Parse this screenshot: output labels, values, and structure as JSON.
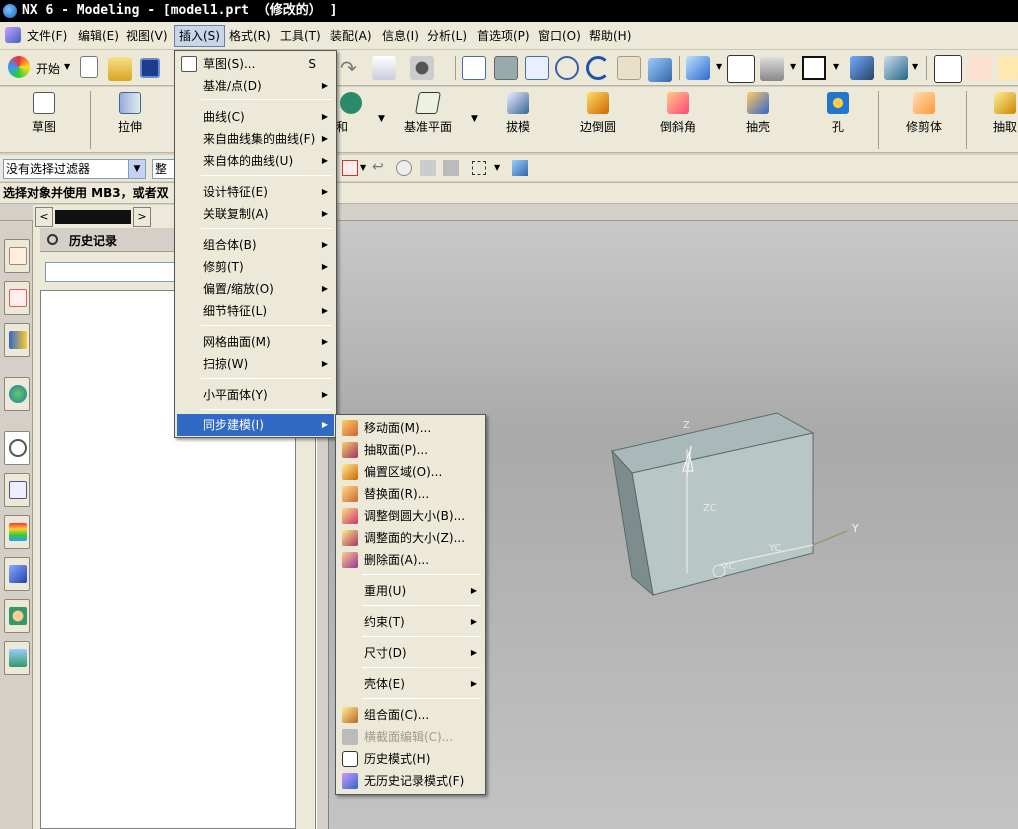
{
  "window": {
    "title": "NX 6 - Modeling - [model1.prt （修改的） ]"
  },
  "menubar": [
    {
      "label": "文件(F)"
    },
    {
      "label": "编辑(E)"
    },
    {
      "label": "视图(V)"
    },
    {
      "label": "插入(S)"
    },
    {
      "label": "格式(R)"
    },
    {
      "label": "工具(T)"
    },
    {
      "label": "装配(A)"
    },
    {
      "label": "信息(I)"
    },
    {
      "label": "分析(L)"
    },
    {
      "label": "首选项(P)"
    },
    {
      "label": "窗口(O)"
    },
    {
      "label": "帮助(H)"
    }
  ],
  "toolbar": {
    "start_label": "开始"
  },
  "feature_toolbar": [
    {
      "label": "草图"
    },
    {
      "label": "拉伸"
    },
    {
      "label": "和"
    },
    {
      "label": "基准平面"
    },
    {
      "label": "拔模"
    },
    {
      "label": "边倒圆"
    },
    {
      "label": "倒斜角"
    },
    {
      "label": "抽壳"
    },
    {
      "label": "孔"
    },
    {
      "label": "修剪体"
    },
    {
      "label": "抽取"
    }
  ],
  "filter": {
    "value": "没有选择过滤器",
    "scope": "整个"
  },
  "status": {
    "prompt": "选择对象并使用 MB3，或者双"
  },
  "history": {
    "title": "历史记录"
  },
  "insert_menu": {
    "items": [
      {
        "label": "草图(S)...",
        "shortcut": "S"
      },
      {
        "label": "基准/点(D)"
      },
      {
        "label": "曲线(C)"
      },
      {
        "label": "来自曲线集的曲线(F)"
      },
      {
        "label": "来自体的曲线(U)"
      },
      {
        "label": "设计特征(E)"
      },
      {
        "label": "关联复制(A)"
      },
      {
        "label": "组合体(B)"
      },
      {
        "label": "修剪(T)"
      },
      {
        "label": "偏置/缩放(O)"
      },
      {
        "label": "细节特征(L)"
      },
      {
        "label": "网格曲面(M)"
      },
      {
        "label": "扫掠(W)"
      },
      {
        "label": "小平面体(Y)"
      },
      {
        "label": "同步建模(I)"
      }
    ]
  },
  "sync_menu": {
    "items": [
      {
        "label": "移动面(M)..."
      },
      {
        "label": "抽取面(P)..."
      },
      {
        "label": "偏置区域(O)..."
      },
      {
        "label": "替换面(R)..."
      },
      {
        "label": "调整倒圆大小(B)..."
      },
      {
        "label": "调整面的大小(Z)..."
      },
      {
        "label": "删除面(A)..."
      },
      {
        "label": "重用(U)"
      },
      {
        "label": "约束(T)"
      },
      {
        "label": "尺寸(D)"
      },
      {
        "label": "壳体(E)"
      },
      {
        "label": "组合面(C)..."
      },
      {
        "label": "横截面编辑(C)..."
      },
      {
        "label": "历史模式(H)"
      },
      {
        "label": "无历史记录模式(F)"
      }
    ]
  },
  "model": {
    "axis_z": "Z",
    "axis_zc": "ZC",
    "axis_yc": "YC",
    "axis_y": "Y",
    "axis_xc": "XC"
  }
}
